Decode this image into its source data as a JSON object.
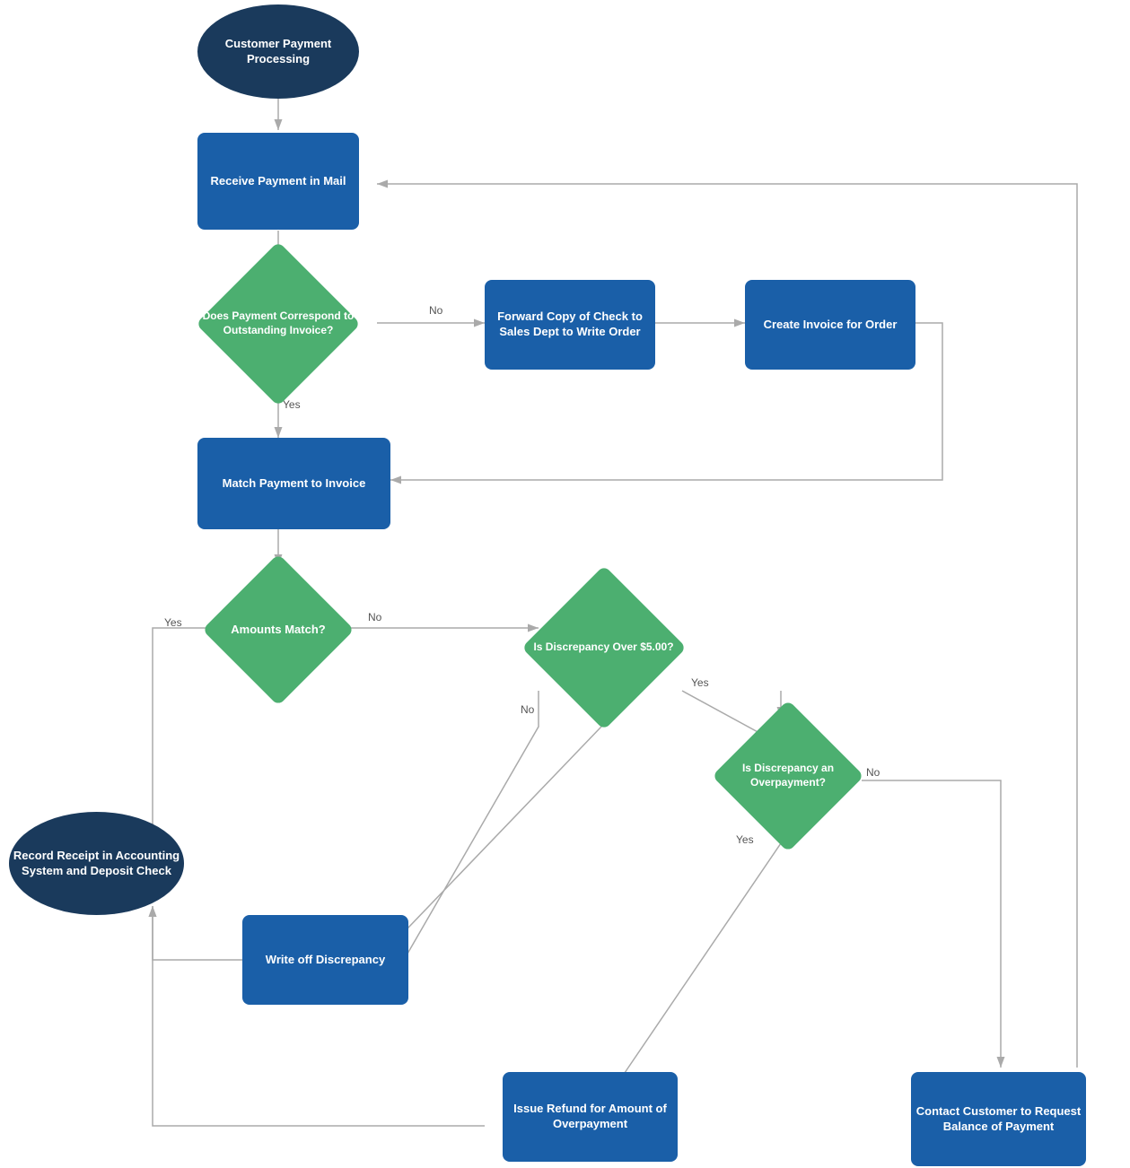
{
  "nodes": {
    "start": {
      "label": "Customer Payment Processing",
      "type": "ellipse",
      "color": "dark-blue"
    },
    "receive_payment": {
      "label": "Receive Payment in Mail",
      "type": "rounded-rect",
      "color": "medium-blue"
    },
    "does_payment_correspond": {
      "label": "Does Payment Correspond to Outstanding Invoice?",
      "type": "diamond",
      "color": "green"
    },
    "forward_copy": {
      "label": "Forward Copy of Check to Sales Dept to Write Order",
      "type": "rounded-rect",
      "color": "medium-blue"
    },
    "create_invoice": {
      "label": "Create Invoice for Order",
      "type": "rounded-rect",
      "color": "medium-blue"
    },
    "match_payment": {
      "label": "Match Payment to Invoice",
      "type": "rounded-rect",
      "color": "medium-blue"
    },
    "amounts_match": {
      "label": "Amounts Match?",
      "type": "diamond",
      "color": "green"
    },
    "discrepancy_over": {
      "label": "Is Discrepancy Over $5.00?",
      "type": "diamond",
      "color": "green"
    },
    "discrepancy_overpayment": {
      "label": "Is Discrepancy an Overpayment?",
      "type": "diamond",
      "color": "green"
    },
    "write_off": {
      "label": "Write off Discrepancy",
      "type": "rounded-rect",
      "color": "medium-blue"
    },
    "issue_refund": {
      "label": "Issue Refund for Amount of Overpayment",
      "type": "rounded-rect",
      "color": "medium-blue"
    },
    "contact_customer": {
      "label": "Contact Customer to Request Balance of Payment",
      "type": "rounded-rect",
      "color": "medium-blue"
    },
    "record_receipt": {
      "label": "Record Receipt in Accounting System and Deposit Check",
      "type": "ellipse",
      "color": "dark-blue"
    }
  },
  "labels": {
    "yes": "Yes",
    "no": "No"
  }
}
